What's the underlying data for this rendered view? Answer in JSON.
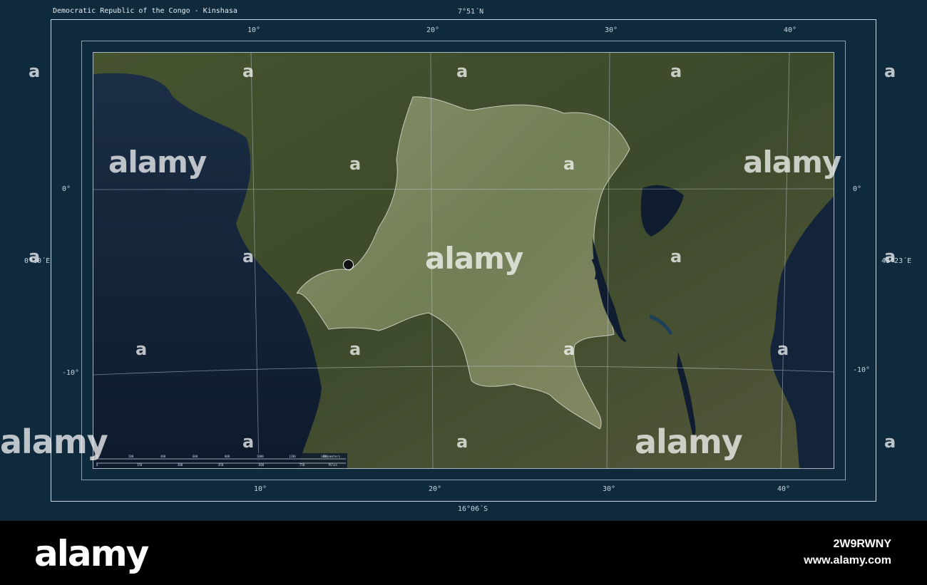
{
  "title": "Democratic Republic of the Congo - Kinshasa",
  "bounds": {
    "north": "7°51´N",
    "south": "16°06´S",
    "west": "0°10´E",
    "east": "43°23´E"
  },
  "longitude_ticks_top": [
    "10°",
    "20°",
    "30°",
    "40°"
  ],
  "longitude_ticks_bottom": [
    "10°",
    "20°",
    "30°",
    "40°"
  ],
  "latitude_ticks_left": [
    "0°",
    "-10°"
  ],
  "latitude_ticks_right": [
    "0°",
    "-10°"
  ],
  "scale_bar": {
    "unit_top": "Kilometers",
    "unit_bottom": "Miles",
    "top_values": [
      "0",
      "200",
      "400",
      "600",
      "800",
      "1000",
      "1200",
      "1400"
    ],
    "bottom_values": [
      "0",
      "150",
      "300",
      "450",
      "600",
      "750"
    ]
  },
  "marker": {
    "name": "Kinshasa"
  },
  "watermark": {
    "logo": "alamy",
    "small": "a",
    "image_id": "2W9RWNY",
    "url": "www.alamy.com"
  },
  "colors": {
    "frame": "#0f2a3d",
    "ocean": "#12253a",
    "land": "#3f4f2f",
    "highlight": "#7e8a62",
    "lake": "#0d1a2e"
  }
}
